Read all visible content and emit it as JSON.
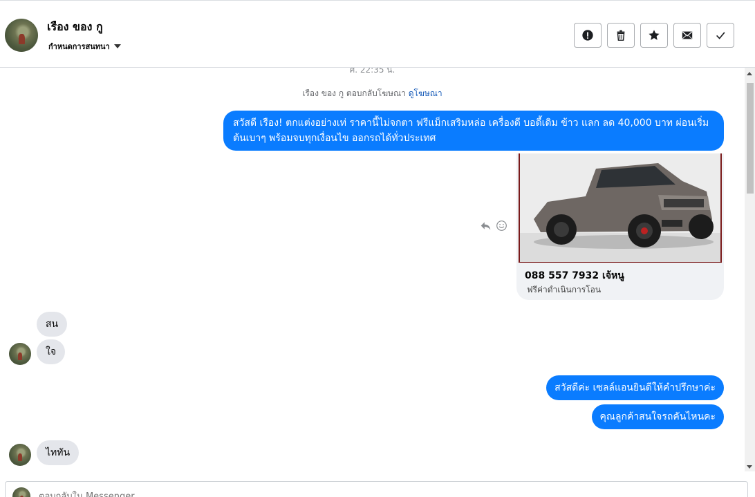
{
  "header": {
    "contact_name": "เรือง ของ กู",
    "status_dropdown": "กำหนดการสนทนา",
    "actions": [
      {
        "name": "report-button",
        "icon": "exclamation-icon"
      },
      {
        "name": "delete-button",
        "icon": "trash-icon"
      },
      {
        "name": "star-button",
        "icon": "star-icon"
      },
      {
        "name": "mark-unread-button",
        "icon": "envelope-icon"
      },
      {
        "name": "mark-done-button",
        "icon": "check-icon"
      }
    ]
  },
  "thread": {
    "timestamp": "ศ. 22:35 น.",
    "ad_reply": {
      "text": "เรือง ของ กู ตอบกลับโฆษณา",
      "link": "ดูโฆษณา"
    },
    "ad_message": "สวัสดี เรือง! ตกแต่งอย่างเท่ ราคานี้ไม่จกตา ฟรีแม็กเสริมหล่อ เครื่องดี บอดี้เดิม ข้าว แลก ลด 40,000 บาท ผ่อนเริ่มต้นเบาๆ พร้อมจบทุกเงื่อนไข ออกรถได้ทั่วประเทศ",
    "ad_card": {
      "title": "088 557 7932 เจ้หนู",
      "subtitle": "ฟรีค่าดำเนินการโอน",
      "image": "pickup-truck-photo"
    },
    "incoming_1": [
      "สน",
      "ใจ"
    ],
    "outgoing_1": [
      "สวัสดีค่ะ  เซลล์แอนยินดีให้คำปรึกษาค่ะ",
      "คุณลูกค้าสนใจรถคันไหนคะ"
    ],
    "incoming_2": [
      "ไททัน"
    ]
  },
  "composer": {
    "placeholder": "ตอบกลับใน Messenger..."
  },
  "colors": {
    "outgoing_bubble": "#0a7cff",
    "incoming_bubble": "#e4e6eb",
    "link": "#1459b8"
  }
}
